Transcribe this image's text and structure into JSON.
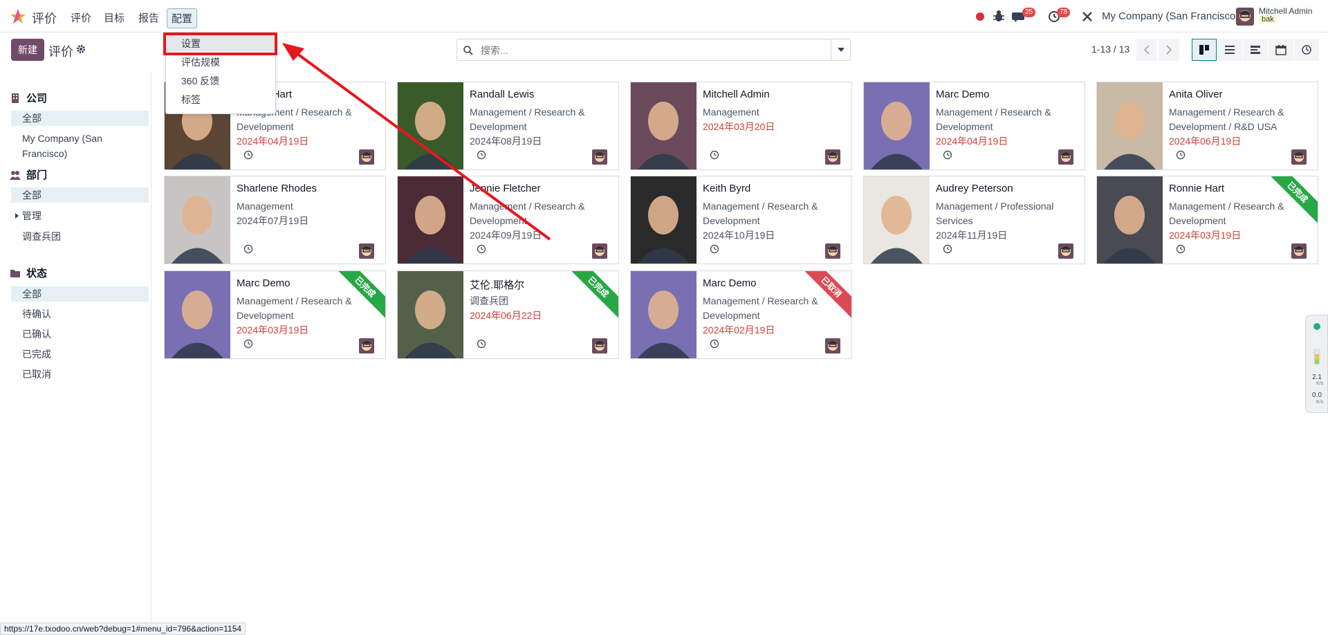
{
  "nav": {
    "app_name": "评价",
    "menus": [
      "评价",
      "目标",
      "报告",
      "配置"
    ],
    "chat_badge": "25",
    "activity_badge": "78",
    "company": "My Company (San Francisco)",
    "user_name": "Mitchell Admin",
    "user_db": "bak"
  },
  "control": {
    "new_label": "新建",
    "title": "评价",
    "search_placeholder": "搜索...",
    "pager": "1-13 / 13"
  },
  "dropdown": {
    "items": [
      "设置",
      "评估规模",
      "360 反馈",
      "标签"
    ]
  },
  "sidebar": {
    "company": {
      "title": "公司",
      "items": [
        "全部",
        "My Company (San Francisco)"
      ]
    },
    "department": {
      "title": "部门",
      "items": [
        "全部",
        "管理",
        "调查兵团"
      ]
    },
    "status": {
      "title": "状态",
      "items": [
        "全部",
        "待确认",
        "已确认",
        "已完成",
        "已取消"
      ]
    }
  },
  "cards": [
    {
      "name": "Ronnie Hart",
      "dept": "Management / Research & Development",
      "date": "2024年04月19日",
      "date_color": "red",
      "ribbon": ""
    },
    {
      "name": "Randall Lewis",
      "dept": "Management / Research & Development",
      "date": "2024年08月19日",
      "date_color": "gray",
      "ribbon": ""
    },
    {
      "name": "Mitchell Admin",
      "dept": "Management",
      "date": "2024年03月20日",
      "date_color": "red",
      "ribbon": ""
    },
    {
      "name": "Marc Demo",
      "dept": "Management / Research & Development",
      "date": "2024年04月19日",
      "date_color": "red",
      "ribbon": ""
    },
    {
      "name": "Anita Oliver",
      "dept": "Management / Research & Development / R&D USA",
      "date": "2024年06月19日",
      "date_color": "red",
      "ribbon": ""
    },
    {
      "name": "Sharlene Rhodes",
      "dept": "Management",
      "date": "2024年07月19日",
      "date_color": "gray",
      "ribbon": ""
    },
    {
      "name": "Jennie Fletcher",
      "dept": "Management / Research & Development",
      "date": "2024年09月19日",
      "date_color": "gray",
      "ribbon": ""
    },
    {
      "name": "Keith Byrd",
      "dept": "Management / Research & Development",
      "date": "2024年10月19日",
      "date_color": "gray",
      "ribbon": ""
    },
    {
      "name": "Audrey Peterson",
      "dept": "Management / Professional Services",
      "date": "2024年11月19日",
      "date_color": "gray",
      "ribbon": ""
    },
    {
      "name": "Ronnie Hart",
      "dept": "Management / Research & Development",
      "date": "2024年03月19日",
      "date_color": "red",
      "ribbon": "已完成",
      "ribbon_color": "green"
    },
    {
      "name": "Marc Demo",
      "dept": "Management / Research & Development",
      "date": "2024年03月19日",
      "date_color": "red",
      "ribbon": "已完成",
      "ribbon_color": "green"
    },
    {
      "name": "艾伦.耶格尔",
      "dept": "调查兵团",
      "date": "2024年06月22日",
      "date_color": "red",
      "ribbon": "已完成",
      "ribbon_color": "green"
    },
    {
      "name": "Marc Demo",
      "dept": "Management / Research & Development",
      "date": "2024年02月19日",
      "date_color": "red",
      "ribbon": "已取消",
      "ribbon_color": "red"
    }
  ],
  "widget": {
    "up": "2.1",
    "down": "0.0",
    "unit": "K/s"
  },
  "status_url": "https://17e.txodoo.cn/web?debug=1#menu_id=796&action=1154"
}
